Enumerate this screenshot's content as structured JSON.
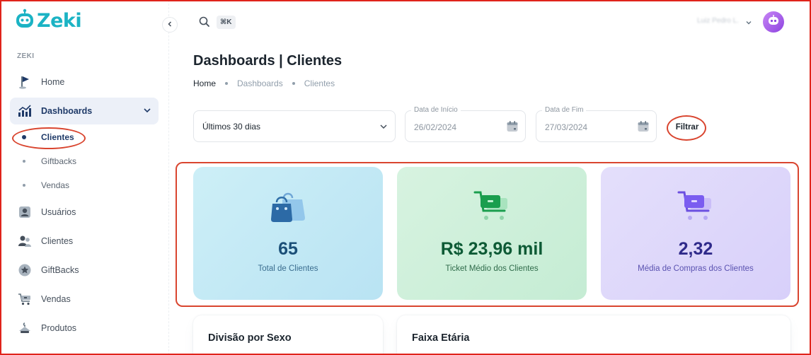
{
  "app": {
    "name": "Zeki"
  },
  "sidebar": {
    "section_label": "ZEKI",
    "items": [
      {
        "label": "Home",
        "icon": "flag-icon"
      },
      {
        "label": "Dashboards",
        "icon": "chart-icon"
      },
      {
        "label": "Usuários",
        "icon": "user-icon"
      },
      {
        "label": "Clientes",
        "icon": "users-icon"
      },
      {
        "label": "GiftBacks",
        "icon": "star-icon"
      },
      {
        "label": "Vendas",
        "icon": "cart-icon"
      },
      {
        "label": "Produtos",
        "icon": "hanger-icon"
      }
    ],
    "dashboards_sub": [
      {
        "label": "Clientes",
        "active": true
      },
      {
        "label": "Giftbacks",
        "active": false
      },
      {
        "label": "Vendas",
        "active": false
      }
    ]
  },
  "topbar": {
    "shortcut": "⌘K",
    "user_name": "Luiz Pedro L."
  },
  "page": {
    "title": "Dashboards | Clientes",
    "breadcrumb": [
      "Home",
      "Dashboards",
      "Clientes"
    ]
  },
  "filters": {
    "period_value": "Últimos 30 dias",
    "start_label": "Data de Início",
    "start_value": "26/02/2024",
    "end_label": "Data de Fim",
    "end_value": "27/03/2024",
    "filter_button": "Filtrar"
  },
  "cards": [
    {
      "value": "65",
      "label": "Total de Clientes",
      "color": "#1b4f78",
      "label_color": "#3a6d8f"
    },
    {
      "value": "R$ 23,96 mil",
      "label": "Ticket Médio dos Clientes",
      "color": "#0d5a35",
      "label_color": "#2f6b4a"
    },
    {
      "value": "2,32",
      "label": "Média de Compras dos Clientes",
      "color": "#2f2a8a",
      "label_color": "#5a52b0"
    }
  ],
  "panels": [
    {
      "title": "Divisão por Sexo"
    },
    {
      "title": "Faixa Etária"
    }
  ],
  "colors": {
    "brand": "#1bb3c4",
    "active_nav_bg": "#ecf0f8",
    "annotation_red": "#d9452f"
  }
}
